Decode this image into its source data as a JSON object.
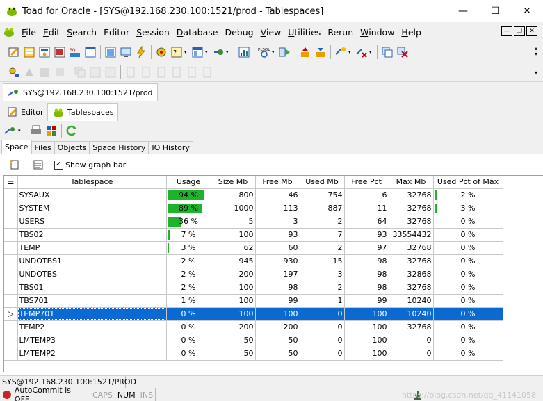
{
  "window": {
    "title": "Toad for Oracle - [SYS@192.168.230.100:1521/prod - Tablespaces]"
  },
  "menu": [
    {
      "label": "File",
      "u": "F",
      "rest": "ile"
    },
    {
      "label": "Edit",
      "u": "E",
      "rest": "dit"
    },
    {
      "label": "Search",
      "u": "S",
      "rest": "earch"
    },
    {
      "label": "Editor",
      "u": "",
      "rest": "Editor"
    },
    {
      "label": "Session",
      "u": "S",
      "rest": "ession"
    },
    {
      "label": "Database",
      "u": "D",
      "rest": "atabase"
    },
    {
      "label": "Debug",
      "u": "",
      "rest": "Debug"
    },
    {
      "label": "View",
      "u": "V",
      "rest": "iew"
    },
    {
      "label": "Utilities",
      "u": "U",
      "rest": "tilities"
    },
    {
      "label": "Rerun",
      "u": "",
      "rest": "Rerun"
    },
    {
      "label": "Window",
      "u": "W",
      "rest": "indow"
    },
    {
      "label": "Help",
      "u": "H",
      "rest": "elp"
    }
  ],
  "connection_tab": {
    "label": "SYS@192.168.230.100:1521/prod"
  },
  "window_tabs": [
    {
      "label": "Editor",
      "icon": "editor-icon"
    },
    {
      "label": "Tablespaces",
      "icon": "tablespaces-icon"
    }
  ],
  "subtabs": [
    "Space",
    "Files",
    "Objects",
    "Space History",
    "IO History"
  ],
  "options": {
    "show_graph_bar": "Show graph bar",
    "show_graph_bar_checked": true
  },
  "grid": {
    "columns": [
      "Tablespace",
      "Usage",
      "Size Mb",
      "Free Mb",
      "Used Mb",
      "Free Pct",
      "Max Mb",
      "Used Pct of Max"
    ],
    "rows": [
      {
        "name": "SYSAUX",
        "usage": "94 %",
        "usage_pct": 94,
        "size": "800",
        "free": "46",
        "used": "754",
        "free_pct": "6",
        "max": "32768",
        "used_max": "2 %",
        "used_max_bar": true
      },
      {
        "name": "SYSTEM",
        "usage": "89 %",
        "usage_pct": 89,
        "size": "1000",
        "free": "113",
        "used": "887",
        "free_pct": "11",
        "max": "32768",
        "used_max": "3 %",
        "used_max_bar": true
      },
      {
        "name": "USERS",
        "usage": "36 %",
        "usage_pct": 36,
        "size": "5",
        "free": "3",
        "used": "2",
        "free_pct": "64",
        "max": "32768",
        "used_max": "0 %",
        "used_max_bar": false
      },
      {
        "name": "TBS02",
        "usage": "7 %",
        "usage_pct": 7,
        "size": "100",
        "free": "93",
        "used": "7",
        "free_pct": "93",
        "max": "33554432",
        "used_max": "0 %",
        "used_max_bar": false
      },
      {
        "name": "TEMP",
        "usage": "3 %",
        "usage_pct": 3,
        "size": "62",
        "free": "60",
        "used": "2",
        "free_pct": "97",
        "max": "32768",
        "used_max": "0 %",
        "used_max_bar": false
      },
      {
        "name": "UNDOTBS1",
        "usage": "2 %",
        "usage_pct": 2,
        "size": "945",
        "free": "930",
        "used": "15",
        "free_pct": "98",
        "max": "32768",
        "used_max": "0 %",
        "used_max_bar": false
      },
      {
        "name": "UNDOTBS",
        "usage": "2 %",
        "usage_pct": 2,
        "size": "200",
        "free": "197",
        "used": "3",
        "free_pct": "98",
        "max": "32868",
        "used_max": "0 %",
        "used_max_bar": false
      },
      {
        "name": "TBS01",
        "usage": "2 %",
        "usage_pct": 2,
        "size": "100",
        "free": "98",
        "used": "2",
        "free_pct": "98",
        "max": "32768",
        "used_max": "0 %",
        "used_max_bar": false
      },
      {
        "name": "TBS701",
        "usage": "1 %",
        "usage_pct": 1,
        "size": "100",
        "free": "99",
        "used": "1",
        "free_pct": "99",
        "max": "10240",
        "used_max": "0 %",
        "used_max_bar": false
      },
      {
        "name": "TEMP701",
        "usage": "0 %",
        "usage_pct": 0,
        "size": "100",
        "free": "100",
        "used": "0",
        "free_pct": "100",
        "max": "10240",
        "used_max": "0 %",
        "used_max_bar": false,
        "selected": true
      },
      {
        "name": "TEMP2",
        "usage": "0 %",
        "usage_pct": 0,
        "size": "200",
        "free": "200",
        "used": "0",
        "free_pct": "100",
        "max": "32768",
        "used_max": "0 %",
        "used_max_bar": false
      },
      {
        "name": "LMTEMP3",
        "usage": "0 %",
        "usage_pct": 0,
        "size": "50",
        "free": "50",
        "used": "0",
        "free_pct": "100",
        "max": "0",
        "used_max": "0 %",
        "used_max_bar": false
      },
      {
        "name": "LMTEMP2",
        "usage": "0 %",
        "usage_pct": 0,
        "size": "50",
        "free": "50",
        "used": "0",
        "free_pct": "100",
        "max": "0",
        "used_max": "0 %",
        "used_max_bar": false
      }
    ]
  },
  "status": {
    "connection": "SYS@192.168.230.100:1521/PROD",
    "autocommit": "AutoCommit is OFF",
    "caps": "CAPS",
    "num": "NUM",
    "ins": "INS",
    "watermark": "https://blog.csdn.net/qq_41141058"
  },
  "colors": {
    "bar_green": "#1db42b",
    "selection": "#0a6ad2"
  }
}
